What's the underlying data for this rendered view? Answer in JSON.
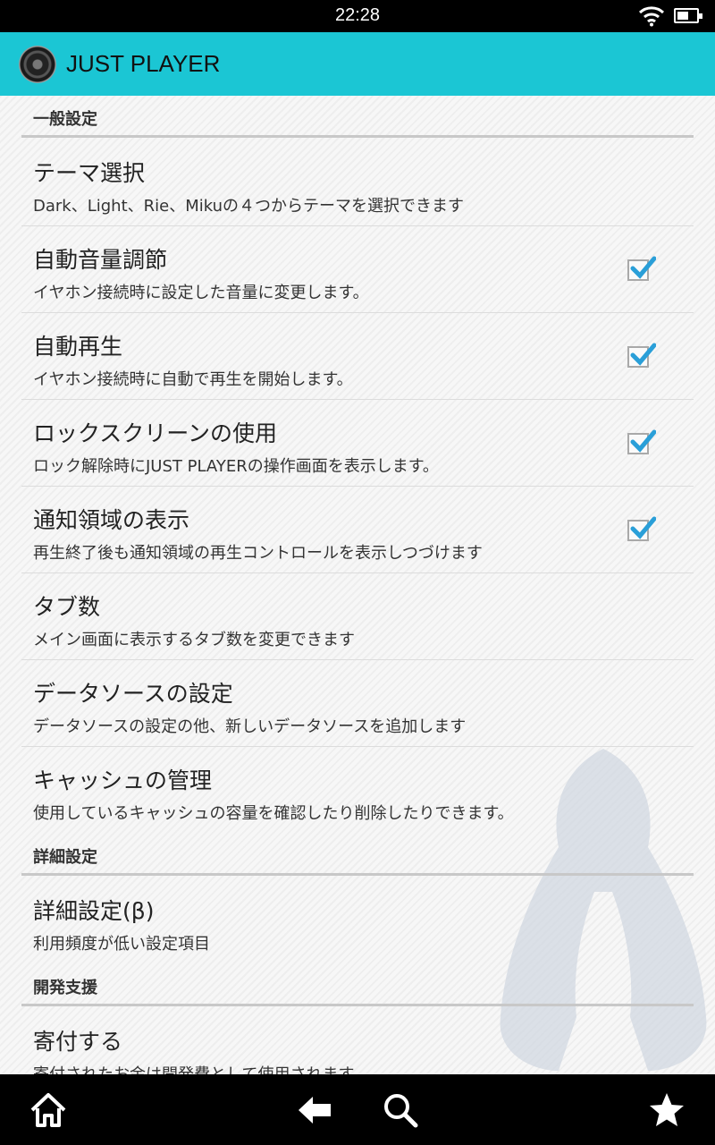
{
  "status_bar": {
    "time": "22:28",
    "icons": [
      "wifi-icon",
      "battery-icon"
    ]
  },
  "app": {
    "title": "JUST PLAYER",
    "accent_color": "#1bc6d4"
  },
  "sections": [
    {
      "header": "一般設定",
      "items": [
        {
          "title": "テーマ選択",
          "summary": "Dark、Light、Rie、Mikuの４つからテーマを選択できます",
          "checkbox": null
        },
        {
          "title": "自動音量調節",
          "summary": "イヤホン接続時に設定した音量に変更します。",
          "checkbox": true
        },
        {
          "title": "自動再生",
          "summary": "イヤホン接続時に自動で再生を開始します。",
          "checkbox": true
        },
        {
          "title": "ロックスクリーンの使用",
          "summary": "ロック解除時にJUST PLAYERの操作画面を表示します。",
          "checkbox": true
        },
        {
          "title": "通知領域の表示",
          "summary": "再生終了後も通知領域の再生コントロールを表示しつづけます",
          "checkbox": true
        },
        {
          "title": "タブ数",
          "summary": "メイン画面に表示するタブ数を変更できます",
          "checkbox": null
        },
        {
          "title": "データソースの設定",
          "summary": "データソースの設定の他、新しいデータソースを追加します",
          "checkbox": null
        },
        {
          "title": "キャッシュの管理",
          "summary": "使用しているキャッシュの容量を確認したり削除したりできます。",
          "checkbox": null
        }
      ]
    },
    {
      "header": "詳細設定",
      "items": [
        {
          "title": "詳細設定(β)",
          "summary": "利用頻度が低い設定項目",
          "checkbox": null
        }
      ]
    },
    {
      "header": "開発支援",
      "items": [
        {
          "title": "寄付する",
          "summary": "寄付されたお金は開発費として使用されます。",
          "checkbox": null
        }
      ]
    }
  ],
  "checkbox_check_color": "#2a9fd8",
  "nav_bar": {
    "buttons": [
      "home-icon",
      "back-icon",
      "search-icon",
      "star-icon"
    ]
  }
}
